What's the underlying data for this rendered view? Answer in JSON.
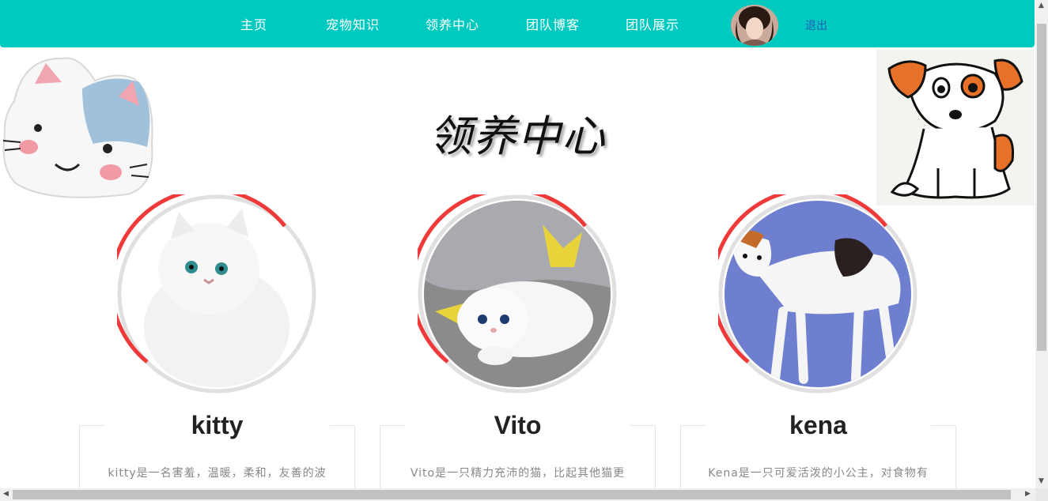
{
  "nav": {
    "items": [
      {
        "label": "主页"
      },
      {
        "label": "宠物知识"
      },
      {
        "label": "领养中心"
      },
      {
        "label": "团队博客"
      },
      {
        "label": "团队展示"
      }
    ],
    "logout_label": "退出",
    "bg_color": "#00c9bf"
  },
  "page": {
    "title": "领养中心"
  },
  "pets": [
    {
      "name": "kitty",
      "desc": "kitty是一名害羞，温暖，柔和，友善的波"
    },
    {
      "name": "Vito",
      "desc": "Vito是一只精力充沛的猫，比起其他猫更"
    },
    {
      "name": "kena",
      "desc": "Kena是一只可爱活泼的小公主，对食物有"
    }
  ],
  "colors": {
    "ring_accent": "#f03a3a",
    "ring_base": "#e0e0e0"
  },
  "icons": {
    "vscroll_up": "triangle-up-icon",
    "vscroll_down": "triangle-down-icon",
    "hscroll_left": "triangle-left-icon",
    "hscroll_right": "triangle-right-icon"
  }
}
